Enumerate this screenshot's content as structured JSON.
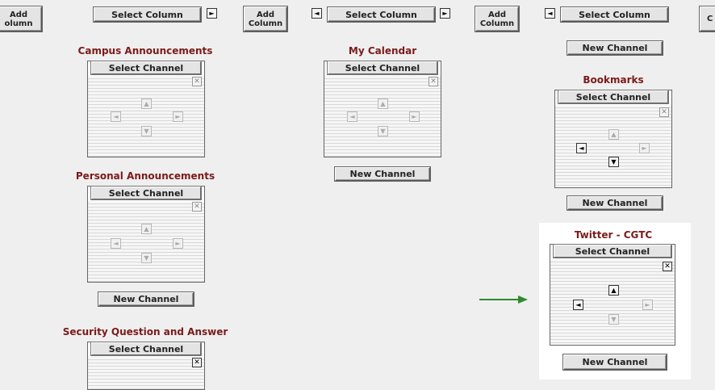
{
  "toolbar": {
    "add_column_label": "Add\nColumn",
    "add_column_partial_left": "Add\nolumn",
    "add_column_partial_right": "C",
    "select_column_label": "Select Column",
    "left_arrow": "◄",
    "right_arrow": "►"
  },
  "columns": [
    {
      "channels": [
        {
          "title": "Campus Announcements"
        },
        {
          "title": "Personal Announcements"
        },
        {
          "title": "Security Question and Answer"
        }
      ]
    },
    {
      "channels": [
        {
          "title": "My Calendar"
        }
      ]
    },
    {
      "channels": [
        {
          "title": "Bookmarks"
        },
        {
          "title": "Twitter - CGTC"
        }
      ]
    }
  ],
  "labels": {
    "select_channel": "Select Channel",
    "new_channel": "New Channel",
    "close": "✕",
    "up": "▲",
    "down": "▼",
    "left": "◄",
    "right": "►"
  },
  "colors": {
    "title": "#7b1a1a",
    "highlight_arrow": "#2e8b2e"
  }
}
